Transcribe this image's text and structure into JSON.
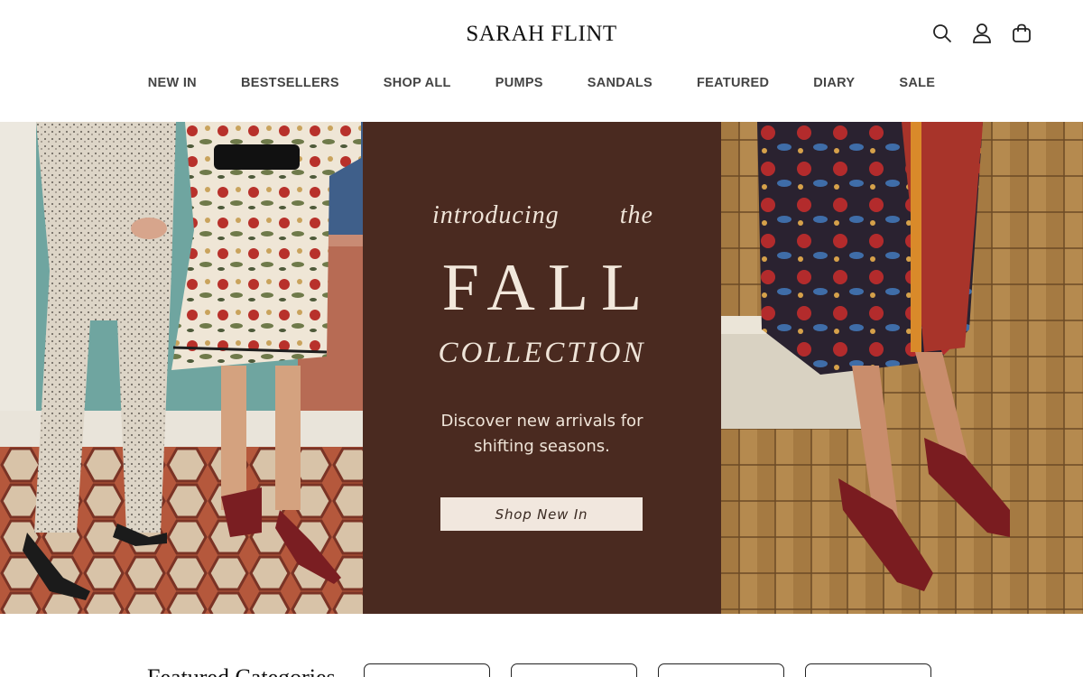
{
  "header": {
    "logo": "SARAH FLINT",
    "icons": [
      "search-icon",
      "account-icon",
      "cart-icon"
    ]
  },
  "nav": {
    "items": [
      "NEW IN",
      "BESTSELLERS",
      "SHOP ALL",
      "PUMPS",
      "SANDALS",
      "FEATURED",
      "DIARY",
      "SALE"
    ]
  },
  "hero": {
    "intro_word1": "introducing",
    "intro_word2": "the",
    "headline": "FALL",
    "subheadline": "COLLECTION",
    "description": "Discover new arrivals for shifting seasons.",
    "cta_label": "Shop New In",
    "colors": {
      "panel_bg": "#4a2a20",
      "text": "#efe4d8",
      "button_bg": "#f1e7de"
    }
  },
  "featured": {
    "title": "Featured Categories"
  }
}
